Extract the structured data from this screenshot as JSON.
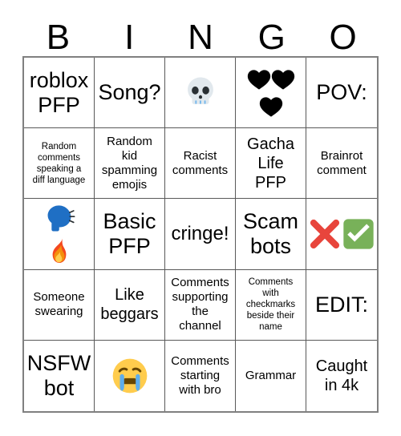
{
  "card": {
    "title": "BINGO card",
    "header_letters": [
      "B",
      "I",
      "N",
      "G",
      "O"
    ],
    "columns": 5,
    "rows": 5,
    "colors": {
      "background": "#ffffff",
      "text": "#000000",
      "grid_line": "#595959",
      "grid_outer": "#808080",
      "heart": "#000000",
      "cross_mark_red": "#e8453c",
      "check_mark_green": "#78b159",
      "check_mark_white": "#ffffff",
      "speaking_head_blue": "#1f6fc4",
      "fire_orange": "#f4900c",
      "fire_red": "#f4481e",
      "fire_yellow": "#ffcc4d",
      "skull_pale": "#e1e8ed",
      "crying_face_yellow": "#ffcc4d",
      "tear_blue": "#5dadec"
    }
  },
  "cells": [
    {
      "id": "b1",
      "column": "B",
      "row": 1,
      "type": "text",
      "text": "roblox\nPFP",
      "size": "sz-xl"
    },
    {
      "id": "i1",
      "column": "I",
      "row": 1,
      "type": "text",
      "text": "Song?",
      "size": "sz-xl"
    },
    {
      "id": "n1",
      "column": "N",
      "row": 1,
      "type": "emoji",
      "emoji_name": "skull-emoji",
      "text": "💀"
    },
    {
      "id": "g1",
      "column": "G",
      "row": 1,
      "type": "emoji",
      "emoji_name": "black-hearts-emoji",
      "text": "🖤🖤\n🖤"
    },
    {
      "id": "o1",
      "column": "O",
      "row": 1,
      "type": "text",
      "text": "POV:",
      "size": "sz-xl"
    },
    {
      "id": "b2",
      "column": "B",
      "row": 2,
      "type": "text",
      "text": "Random\ncomments\nspeaking a\ndiff language",
      "size": "sz-xs"
    },
    {
      "id": "i2",
      "column": "I",
      "row": 2,
      "type": "text",
      "text": "Random\nkid\nspamming\nemojis",
      "size": "sz-sm"
    },
    {
      "id": "n2",
      "column": "N",
      "row": 2,
      "type": "text",
      "text": "Racist\ncomments",
      "size": "sz-sm"
    },
    {
      "id": "g2",
      "column": "G",
      "row": 2,
      "type": "text",
      "text": "Gacha\nLife\nPFP",
      "size": "sz-md"
    },
    {
      "id": "o2",
      "column": "O",
      "row": 2,
      "type": "text",
      "text": "Brainrot\ncomment",
      "size": "sz-sm"
    },
    {
      "id": "b3",
      "column": "B",
      "row": 3,
      "type": "emoji",
      "emoji_name": "speaking-head-fire-emoji",
      "text": "🗣️\n🔥"
    },
    {
      "id": "i3",
      "column": "I",
      "row": 3,
      "type": "text",
      "text": "Basic\nPFP",
      "size": "sz-xl"
    },
    {
      "id": "n3",
      "column": "N",
      "row": 3,
      "type": "text",
      "text": "cringe!",
      "size": "sz-lg"
    },
    {
      "id": "g3",
      "column": "G",
      "row": 3,
      "type": "text",
      "text": "Scam\nbots",
      "size": "sz-xl"
    },
    {
      "id": "o3",
      "column": "O",
      "row": 3,
      "type": "emoji",
      "emoji_name": "cross-mark-check-mark-emoji",
      "text": "❌✅"
    },
    {
      "id": "b4",
      "column": "B",
      "row": 4,
      "type": "text",
      "text": "Someone\nswearing",
      "size": "sz-sm"
    },
    {
      "id": "i4",
      "column": "I",
      "row": 4,
      "type": "text",
      "text": "Like\nbeggars",
      "size": "sz-md"
    },
    {
      "id": "n4",
      "column": "N",
      "row": 4,
      "type": "text",
      "text": "Comments\nsupporting\nthe\nchannel",
      "size": "sz-sm"
    },
    {
      "id": "g4",
      "column": "G",
      "row": 4,
      "type": "text",
      "text": "Comments\nwith\ncheckmarks\nbeside their\nname",
      "size": "sz-xs"
    },
    {
      "id": "o4",
      "column": "O",
      "row": 4,
      "type": "text",
      "text": "EDIT:",
      "size": "sz-xl"
    },
    {
      "id": "b5",
      "column": "B",
      "row": 5,
      "type": "text",
      "text": "NSFW\nbot",
      "size": "sz-xl"
    },
    {
      "id": "i5",
      "column": "I",
      "row": 5,
      "type": "emoji",
      "emoji_name": "loudly-crying-face-emoji",
      "text": "😭"
    },
    {
      "id": "n5",
      "column": "N",
      "row": 5,
      "type": "text",
      "text": "Comments\nstarting\nwith bro",
      "size": "sz-sm"
    },
    {
      "id": "g5",
      "column": "G",
      "row": 5,
      "type": "text",
      "text": "Grammar",
      "size": "sz-sm"
    },
    {
      "id": "o5",
      "column": "O",
      "row": 5,
      "type": "text",
      "text": "Caught\nin 4k",
      "size": "sz-md"
    }
  ]
}
